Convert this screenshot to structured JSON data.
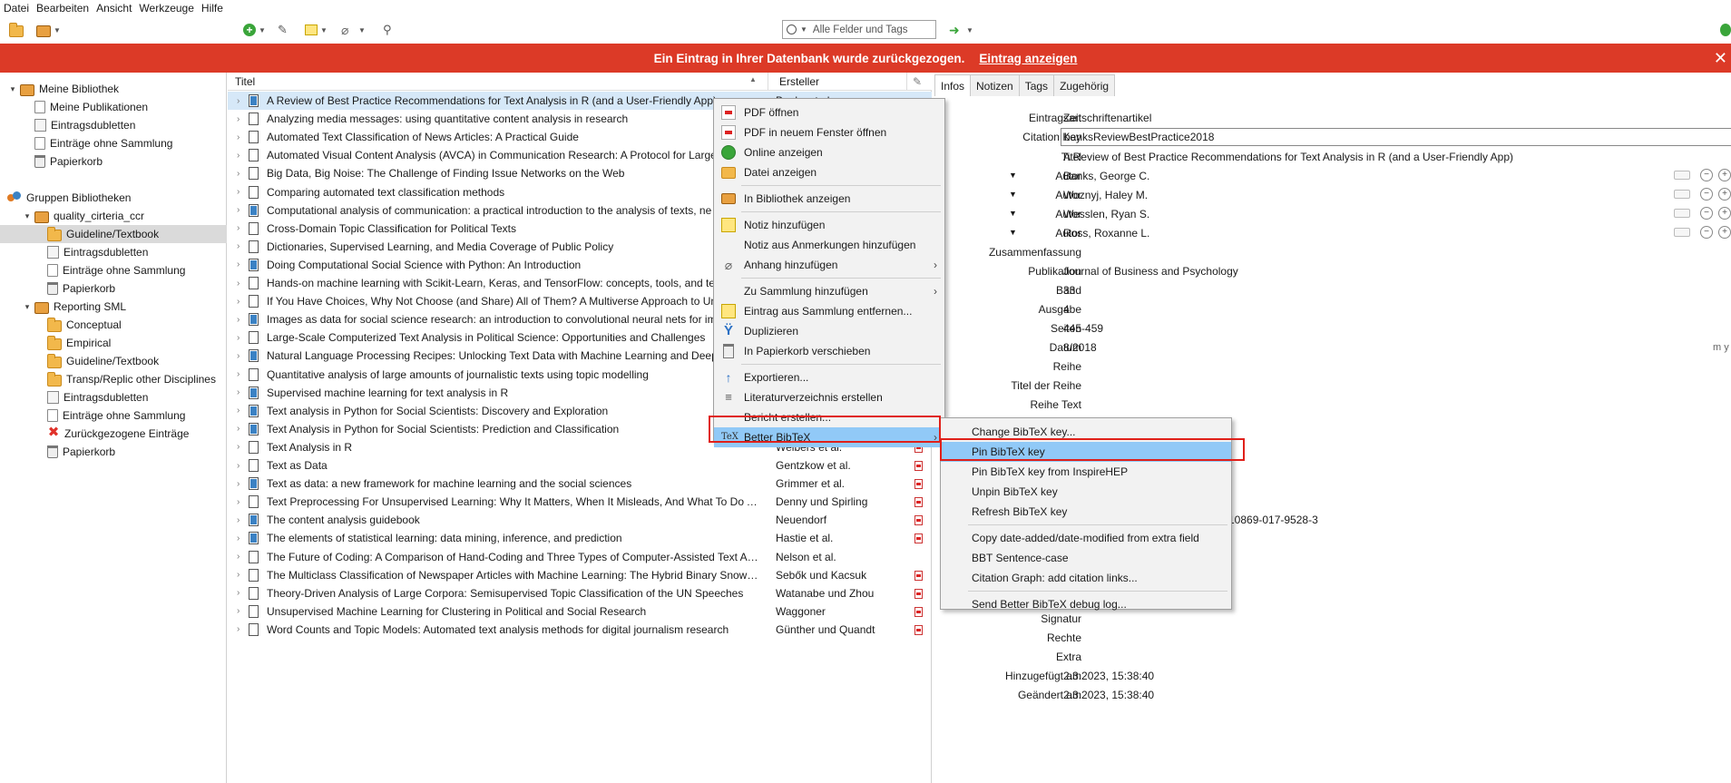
{
  "menubar": [
    "Datei",
    "Bearbeiten",
    "Ansicht",
    "Werkzeuge",
    "Hilfe"
  ],
  "search": {
    "placeholder": "Alle Felder und Tags"
  },
  "banner": {
    "message": "Ein Eintrag in Ihrer Datenbank wurde zurückgezogen.",
    "link": "Eintrag anzeigen",
    "color": "#dc3a27"
  },
  "tree": [
    {
      "label": "Meine Bibliothek",
      "icon": "library-icon",
      "level": 0,
      "twisty": "▾"
    },
    {
      "label": "Meine Publikationen",
      "icon": "document-icon",
      "level": 1
    },
    {
      "label": "Eintragsdubletten",
      "icon": "duplicates-icon",
      "level": 1
    },
    {
      "label": "Einträge ohne Sammlung",
      "icon": "document-icon",
      "level": 1
    },
    {
      "label": "Papierkorb",
      "icon": "trash-icon",
      "level": 1
    },
    {
      "label": "Gruppen Bibliotheken",
      "icon": "group-icon",
      "level": 0
    },
    {
      "label": "quality_cirteria_ccr",
      "icon": "library-icon",
      "level": 1,
      "twisty": "▾"
    },
    {
      "label": "Guideline/Textbook",
      "icon": "folder-icon",
      "level": 2,
      "selected": true
    },
    {
      "label": "Eintragsdubletten",
      "icon": "duplicates-icon",
      "level": 2
    },
    {
      "label": "Einträge ohne Sammlung",
      "icon": "document-icon",
      "level": 2
    },
    {
      "label": "Papierkorb",
      "icon": "trash-icon",
      "level": 2
    },
    {
      "label": "Reporting SML",
      "icon": "library-icon",
      "level": 1,
      "twisty": "▾"
    },
    {
      "label": "Conceptual",
      "icon": "folder-icon",
      "level": 2
    },
    {
      "label": "Empirical",
      "icon": "folder-icon",
      "level": 2
    },
    {
      "label": "Guideline/Textbook",
      "icon": "folder-icon",
      "level": 2
    },
    {
      "label": "Transp/Replic other Disciplines",
      "icon": "folder-icon",
      "level": 2
    },
    {
      "label": "Eintragsdubletten",
      "icon": "duplicates-icon",
      "level": 2
    },
    {
      "label": "Einträge ohne Sammlung",
      "icon": "document-icon",
      "level": 2
    },
    {
      "label": "Zurückgezogene Einträge",
      "icon": "retracted-icon",
      "level": 2
    },
    {
      "label": "Papierkorb",
      "icon": "trash-icon",
      "level": 2
    }
  ],
  "columns": {
    "title": "Titel",
    "creator": "Ersteller"
  },
  "items": [
    {
      "title": "A Review of Best Practice Recommendations for Text Analysis in R (and a User-Friendly App)",
      "creator": "Banks et al.",
      "type": "journal",
      "pdf": false,
      "selected": true
    },
    {
      "title": "Analyzing media messages: using quantitative content analysis in research",
      "creator": "",
      "type": "book",
      "pdf": false
    },
    {
      "title": "Automated Text Classification of News Articles: A Practical Guide",
      "creator": "",
      "type": "book",
      "pdf": false
    },
    {
      "title": "Automated Visual Content Analysis (AVCA) in Communication Research: A Protocol for Large",
      "creator": "",
      "type": "book",
      "pdf": false
    },
    {
      "title": "Big Data, Big Noise: The Challenge of Finding Issue Networks on the Web",
      "creator": "",
      "type": "book",
      "pdf": false
    },
    {
      "title": "Comparing automated text classification methods",
      "creator": "",
      "type": "book",
      "pdf": false
    },
    {
      "title": "Computational analysis of communication: a practical introduction to the analysis of texts, ne",
      "creator": "",
      "type": "journal",
      "pdf": false
    },
    {
      "title": "Cross-Domain Topic Classification for Political Texts",
      "creator": "",
      "type": "book",
      "pdf": false
    },
    {
      "title": "Dictionaries, Supervised Learning, and Media Coverage of Public Policy",
      "creator": "",
      "type": "book",
      "pdf": false
    },
    {
      "title": "Doing Computational Social Science with Python: An Introduction",
      "creator": "",
      "type": "journal",
      "pdf": false
    },
    {
      "title": "Hands-on machine learning with Scikit-Learn, Keras, and TensorFlow: concepts, tools, and tec",
      "creator": "",
      "type": "book",
      "pdf": false
    },
    {
      "title": "If You Have Choices, Why Not Choose (and Share) All of Them? A Multiverse Approach to Unc",
      "creator": "",
      "type": "book",
      "pdf": false
    },
    {
      "title": "Images as data for social science research: an introduction to convolutional neural nets for im",
      "creator": "",
      "type": "journal",
      "pdf": false
    },
    {
      "title": "Large-Scale Computerized Text Analysis in Political Science: Opportunities and Challenges",
      "creator": "",
      "type": "book",
      "pdf": false
    },
    {
      "title": "Natural Language Processing Recipes: Unlocking Text Data with Machine Learning and Deep L",
      "creator": "",
      "type": "journal",
      "pdf": false
    },
    {
      "title": "Quantitative analysis of large amounts of journalistic texts using topic modelling",
      "creator": "",
      "type": "book",
      "pdf": false
    },
    {
      "title": "Supervised machine learning for text analysis in R",
      "creator": "",
      "type": "journal",
      "pdf": false
    },
    {
      "title": "Text analysis in Python for Social Scientists: Discovery and Exploration",
      "creator": "",
      "type": "journal",
      "pdf": false
    },
    {
      "title": "Text Analysis in Python for Social Scientists: Prediction and Classification",
      "creator": "",
      "type": "journal",
      "pdf": false
    },
    {
      "title": "Text Analysis in R",
      "creator": "Welbers et al.",
      "type": "book",
      "pdf": true
    },
    {
      "title": "Text as Data",
      "creator": "Gentzkow et al.",
      "type": "book",
      "pdf": true
    },
    {
      "title": "Text as data: a new framework for machine learning and the social sciences",
      "creator": "Grimmer et al.",
      "type": "journal",
      "pdf": true
    },
    {
      "title": "Text Preprocessing For Unsupervised Learning: Why It Matters, When It Misleads, And What To Do Abo...",
      "creator": "Denny und Spirling",
      "type": "book",
      "pdf": true
    },
    {
      "title": "The content analysis guidebook",
      "creator": "Neuendorf",
      "type": "journal",
      "pdf": true
    },
    {
      "title": "The elements of statistical learning: data mining, inference, and prediction",
      "creator": "Hastie et al.",
      "type": "journal",
      "pdf": true
    },
    {
      "title": "The Future of Coding: A Comparison of Hand-Coding and Three Types of Computer-Assisted Text Anal...",
      "creator": "Nelson et al.",
      "type": "book",
      "pdf": false
    },
    {
      "title": "The Multiclass Classification of Newspaper Articles with Machine Learning: The Hybrid Binary Snowball...",
      "creator": "Sebők und Kacsuk",
      "type": "book",
      "pdf": true
    },
    {
      "title": "Theory-Driven Analysis of Large Corpora: Semisupervised Topic Classification of the UN Speeches",
      "creator": "Watanabe und Zhou",
      "type": "book",
      "pdf": true
    },
    {
      "title": "Unsupervised Machine Learning for Clustering in Political and Social Research",
      "creator": "Waggoner",
      "type": "book",
      "pdf": true
    },
    {
      "title": "Word Counts and Topic Models: Automated text analysis methods for digital journalism research",
      "creator": "Günther und Quandt",
      "type": "book",
      "pdf": true
    }
  ],
  "tabs": [
    "Infos",
    "Notizen",
    "Tags",
    "Zugehörig"
  ],
  "info": {
    "type_label": "Eintragsart",
    "type_value": "Zeitschriftenartikel",
    "key_label": "Citation Key",
    "key_value": "banksReviewBestPractice2018",
    "title_label": "Titel",
    "title_value": "A Review of Best Practice Recommendations for Text Analysis in R (and a User-Friendly App)",
    "authors": [
      {
        "label": "Autor",
        "name": "Banks, George C."
      },
      {
        "label": "Autor",
        "name": "Woznyj, Haley M."
      },
      {
        "label": "Autor",
        "name": "Wesslen, Ryan S."
      },
      {
        "label": "Autor",
        "name": "Ross, Roxanne L."
      }
    ],
    "fields": [
      {
        "label": "Zusammenfassung",
        "value": ""
      },
      {
        "label": "Publikation",
        "value": "Journal of Business and Psychology"
      },
      {
        "label": "Band",
        "value": "33"
      },
      {
        "label": "Ausgabe",
        "value": "4"
      },
      {
        "label": "Seiten",
        "value": "445-459"
      },
      {
        "label": "Datum",
        "value": "8/2018"
      },
      {
        "label": "Reihe",
        "value": ""
      },
      {
        "label": "Titel der Reihe",
        "value": ""
      },
      {
        "label": "Reihe Text",
        "value": ""
      }
    ],
    "date_suffix": "m y",
    "doi_fragment": "10869-017-9528-3",
    "bottom_fields": [
      {
        "label": "Signatur",
        "value": ""
      },
      {
        "label": "Rechte",
        "value": ""
      },
      {
        "label": "Extra",
        "value": ""
      },
      {
        "label": "Hinzugefügt am",
        "value": "2.3.2023, 15:38:40"
      },
      {
        "label": "Geändert am",
        "value": "2.3.2023, 15:38:40"
      }
    ]
  },
  "context_menu": [
    {
      "label": "PDF öffnen",
      "icon": "pdf-icon"
    },
    {
      "label": "PDF in neuem Fenster öffnen",
      "icon": "pdf-icon"
    },
    {
      "label": "Online anzeigen",
      "icon": "globe-icon"
    },
    {
      "label": "Datei anzeigen",
      "icon": "folder-icon"
    },
    {
      "sep": true
    },
    {
      "label": "In Bibliothek anzeigen",
      "icon": "library-icon"
    },
    {
      "sep": true
    },
    {
      "label": "Notiz hinzufügen",
      "icon": "note-icon"
    },
    {
      "label": "Notiz aus Anmerkungen hinzufügen",
      "icon": ""
    },
    {
      "label": "Anhang hinzufügen",
      "icon": "paperclip-icon",
      "submenu": true
    },
    {
      "sep": true
    },
    {
      "label": "Zu Sammlung hinzufügen",
      "icon": "",
      "submenu": true
    },
    {
      "label": "Eintrag aus Sammlung entfernen...",
      "icon": "remove-icon"
    },
    {
      "label": "Duplizieren",
      "icon": "duplicate-icon"
    },
    {
      "label": "In Papierkorb verschieben",
      "icon": "trash-icon"
    },
    {
      "sep": true
    },
    {
      "label": "Exportieren...",
      "icon": "export-icon"
    },
    {
      "label": "Literaturverzeichnis erstellen",
      "icon": "list-icon"
    },
    {
      "label": "Bericht erstellen...",
      "icon": ""
    },
    {
      "label": "Better BibTeX",
      "icon": "tex-icon",
      "submenu": true,
      "highlight": true
    }
  ],
  "bbt_menu": [
    {
      "label": "Change BibTeX key..."
    },
    {
      "label": "Pin BibTeX key",
      "highlight": true
    },
    {
      "label": "Pin BibTeX key from InspireHEP"
    },
    {
      "label": "Unpin BibTeX key"
    },
    {
      "label": "Refresh BibTeX key"
    },
    {
      "sep": true
    },
    {
      "label": "Copy date-added/date-modified from extra field"
    },
    {
      "label": "BBT Sentence-case"
    },
    {
      "label": "Citation Graph: add citation links..."
    },
    {
      "sep": true
    },
    {
      "label": "Send Better BibTeX debug log..."
    }
  ],
  "tex_glyph": "TeX"
}
